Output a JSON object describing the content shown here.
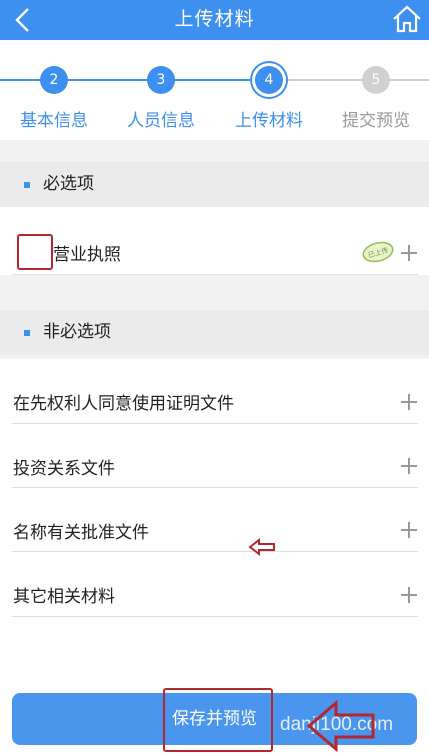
{
  "header": {
    "title": "上传材料"
  },
  "steps": [
    {
      "number": "2",
      "label": "基本信息",
      "state": "done"
    },
    {
      "number": "3",
      "label": "人员信息",
      "state": "done"
    },
    {
      "number": "4",
      "label": "上传材料",
      "state": "current"
    },
    {
      "number": "5",
      "label": "提交预览",
      "state": "todo"
    }
  ],
  "required": {
    "title": "必选项",
    "items": [
      {
        "label": "营业执照",
        "status_badge": "已上传"
      }
    ]
  },
  "optional": {
    "title": "非必选项",
    "items": [
      {
        "label": "在先权利人同意使用证明文件"
      },
      {
        "label": "投资关系文件"
      },
      {
        "label": "名称有关批准文件"
      },
      {
        "label": "其它相关材料"
      }
    ]
  },
  "footer": {
    "save_label": "保存并预览"
  },
  "watermark": "danji100.com",
  "colors": {
    "accent": "#3d8ff0",
    "inactive": "#d0d0d0",
    "annotation": "#b3272d"
  }
}
